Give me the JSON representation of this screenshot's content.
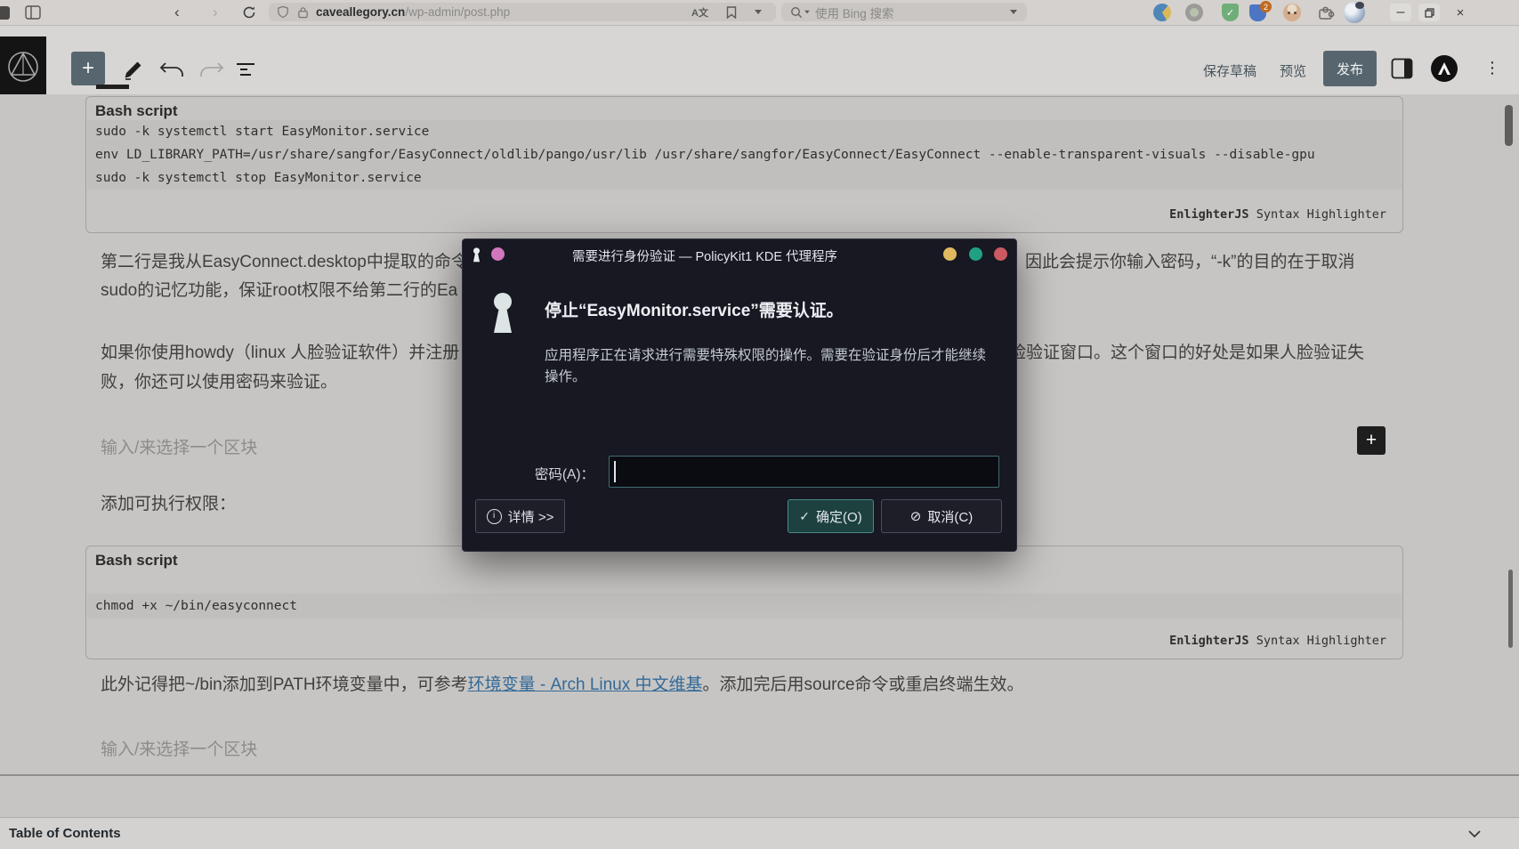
{
  "browser": {
    "domain": "caveallegory.cn",
    "path": "/wp-admin/post.php",
    "search_placeholder": "使用 Bing 搜索",
    "ext_badge": "2"
  },
  "toolbar": {
    "save_draft": "保存草稿",
    "preview": "预览",
    "publish": "发布"
  },
  "bash1": {
    "label": "Bash script",
    "line1": "sudo -k systemctl start EasyMonitor.service",
    "line2": "env LD_LIBRARY_PATH=/usr/share/sangfor/EasyConnect/oldlib/pango/usr/lib /usr/share/sangfor/EasyConnect/EasyConnect --enable-transparent-visuals --disable-gpu",
    "line3": "sudo -k systemctl stop EasyMonitor.service",
    "attr_bold": "EnlighterJS",
    "attr_rest": " Syntax Highlighter"
  },
  "bash2": {
    "label": "Bash script",
    "line1": "chmod +x ~/bin/easyconnect",
    "attr_bold": "EnlighterJS",
    "attr_rest": " Syntax Highlighter"
  },
  "text": {
    "p1l1_left": "第二行是我从EasyConnect.desktop中提取的命令",
    "p1l1_right": "因此会提示你输入密码，“-k”的目的在于取消",
    "p1l2_left": "sudo的记忆功能，保证root权限不给第二行的Ea",
    "p2l1_left": "如果你使用howdy（linux 人脸验证软件）并注册",
    "p2l1_right": "脸验证窗口。这个窗口的好处是如果人脸验证失",
    "p2l2": "败，你还可以使用密码来验证。",
    "placeholder1": "输入/来选择一个区块",
    "add_exec": "添加可执行权限：",
    "link_pre": "此外记得把~/bin添加到PATH环境变量中，可参考",
    "link_text": "环境变量 - Arch Linux 中文维基",
    "link_post": "。添加完后用source命令或重启终端生效。",
    "placeholder2": "输入/来选择一个区块"
  },
  "dialog": {
    "title": "需要进行身份验证 — PolicyKit1 KDE 代理程序",
    "heading": "停止“EasyMonitor.service”需要认证。",
    "desc_line1": "应用程序正在请求进行需要特殊权限的操作。需要在验证身份后才能继续",
    "desc_line2": "操作。",
    "password_label": "密码(A)：",
    "password_value": "",
    "details_label": "详情 >>",
    "ok_label": "确定(O)",
    "cancel_label": "取消(C)"
  },
  "footer": {
    "toc_title": "Table of Contents"
  },
  "colors": {
    "dialog_bg": "#171821",
    "input_border": "#3f6b72",
    "ok_bg": "#1c413f",
    "ok_border": "#4b8b85",
    "traffic_yellow": "#dfb95e",
    "traffic_green": "#21a183",
    "traffic_red": "#cb5a62",
    "app_pink": "#d177be",
    "link_blue": "#336a99"
  }
}
